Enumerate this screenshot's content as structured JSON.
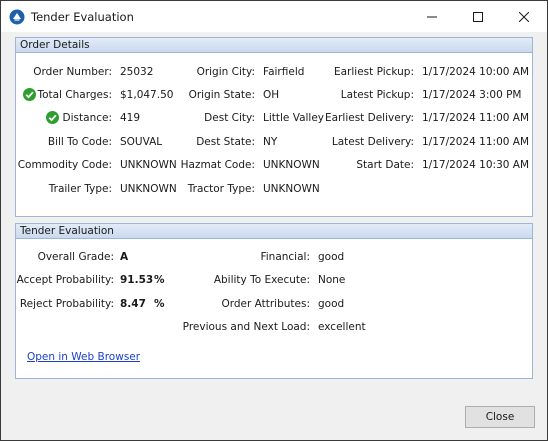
{
  "window": {
    "title": "Tender Evaluation"
  },
  "order_details": {
    "header": "Order Details",
    "rows": [
      {
        "label": "Order Number:",
        "value": "25032"
      },
      {
        "label": "Total Charges:",
        "value": "$1,047.50"
      },
      {
        "label": "Distance:",
        "value": "419"
      },
      {
        "label": "Bill To Code:",
        "value": "SOUVAL"
      },
      {
        "label": "Commodity Code:",
        "value": "UNKNOWN"
      },
      {
        "label": "Trailer Type:",
        "value": "UNKNOWN"
      },
      {
        "label": "Origin City:",
        "value": "Fairfield"
      },
      {
        "label": "Origin State:",
        "value": "OH"
      },
      {
        "label": "Dest City:",
        "value": "Little Valley"
      },
      {
        "label": "Dest State:",
        "value": "NY"
      },
      {
        "label": "Hazmat Code:",
        "value": "UNKNOWN"
      },
      {
        "label": "Tractor Type:",
        "value": "UNKNOWN"
      },
      {
        "label": "Earliest Pickup:",
        "value": "1/17/2024 10:00 AM"
      },
      {
        "label": "Latest Pickup:",
        "value": "1/17/2024 3:00 PM"
      },
      {
        "label": "Earliest Delivery:",
        "value": "1/17/2024 11:00 AM"
      },
      {
        "label": "Latest Delivery:",
        "value": "1/17/2024 11:00 AM"
      },
      {
        "label": "Start Date:",
        "value": "1/17/2024 10:30 AM"
      }
    ]
  },
  "tender_evaluation": {
    "header": "Tender Evaluation",
    "overall_grade_label": "Overall Grade:",
    "overall_grade": "A",
    "accept_label": "Accept Probability:",
    "accept_value": "91.53",
    "accept_unit": "%",
    "reject_label": "Reject Probability:",
    "reject_value": "8.47",
    "reject_unit": "%",
    "rows": [
      {
        "label": "Financial:",
        "value": "good"
      },
      {
        "label": "Ability To Execute:",
        "value": "None"
      },
      {
        "label": "Order Attributes:",
        "value": "good"
      },
      {
        "label": "Previous and Next Load:",
        "value": "excellent"
      }
    ],
    "link": "Open in Web Browser"
  },
  "footer": {
    "close_label": "Close"
  },
  "colors": {
    "check_green": "#2e9e2e",
    "group_border": "#9eb6d4",
    "link": "#1a3fcc"
  }
}
